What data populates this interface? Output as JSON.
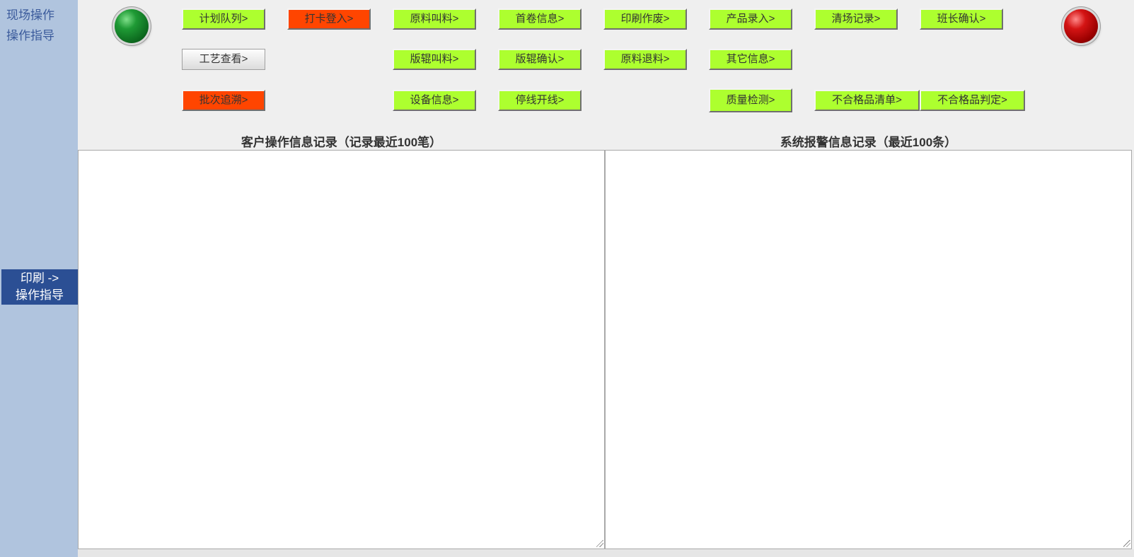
{
  "sidebar": {
    "links": [
      {
        "label": "现场操作"
      },
      {
        "label": "操作指导"
      }
    ],
    "active": {
      "line1": "印刷 ->",
      "line2": "操作指导"
    }
  },
  "indicators": {
    "left_status": "green",
    "right_status": "red"
  },
  "buttons": {
    "plan_queue": "计划队列>",
    "clock_in": "打卡登入>",
    "material_call": "原料叫料>",
    "first_roll_info": "首卷信息>",
    "print_scrap": "印刷作废>",
    "product_entry": "产品录入>",
    "clearance_record": "清场记录>",
    "shift_leader_confirm": "班长确认>",
    "process_view": "工艺查看>",
    "roller_call": "版辊叫料>",
    "roller_confirm": "版辊确认>",
    "material_return": "原料退料>",
    "other_info": "其它信息>",
    "batch_trace": "批次追溯>",
    "equipment_info": "设备信息>",
    "line_stop_start": "停线开线>",
    "quality_check": "质量检测>",
    "nonconforming_list": "不合格品清单>",
    "nonconforming_judge": "不合格品判定>"
  },
  "colors": {
    "green_button": "#adff2f",
    "red_button": "#ff4500",
    "sidebar_bg": "#b0c4de",
    "sidebar_active": "#2b4f94"
  },
  "panels": {
    "operation_log_title": "客户操作信息记录（记录最近100笔）",
    "alarm_log_title": "系统报警信息记录（最近100条）",
    "operation_log_value": "",
    "alarm_log_value": ""
  }
}
